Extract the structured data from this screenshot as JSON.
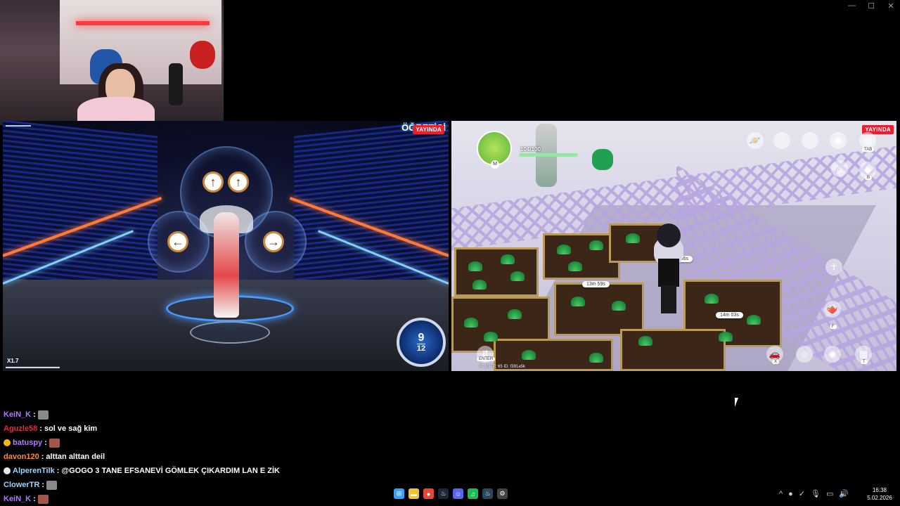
{
  "window": {
    "minimize_glyph": "—",
    "maximize_glyph": "☐",
    "close_glyph": "✕"
  },
  "left_game": {
    "top_right_title": "ÖĞRETİCİ",
    "live_badge": "YAYINDA",
    "combo_current": "9",
    "combo_total": "12",
    "multiplier": "X1.7",
    "arrow_up_1": "↑",
    "arrow_up_2": "↑",
    "arrow_left": "←",
    "arrow_right": "→"
  },
  "right_game": {
    "live_badge": "YAYINDA",
    "hp": "104/100",
    "minimap_key": "M",
    "timers": [
      "14m 06s",
      "13m 59s",
      "14m 03s"
    ],
    "enter_label": "ENTER",
    "tab_label": "TAB",
    "b_label": "B",
    "f_label": "F",
    "x_label": "X",
    "t_label": "T",
    "stats": "F: 109   P: 65   ID: f391a5k"
  },
  "chat": [
    {
      "user": "KeiN_K",
      "color": "#b27cff",
      "sep": ":",
      "message": "",
      "emote": "#8a8a8a",
      "badge": null
    },
    {
      "user": "Aguzle58",
      "color": "#e02b3c",
      "sep": ":",
      "message": "sol ve sağ kim",
      "emote": null,
      "badge": null
    },
    {
      "user": "batuspy",
      "color": "#b27cff",
      "sep": ":",
      "message": "",
      "emote": "#a0564a",
      "badge": "#f2b90c"
    },
    {
      "user": "davon120",
      "color": "#ff8a3a",
      "sep": ":",
      "message": "alttan alttan deil",
      "emote": null,
      "badge": null
    },
    {
      "user": "AlperenTilk",
      "color": "#9fd4ff",
      "sep": ":",
      "message": "@GOGO 3 TANE EFSANEVİ GÖMLEK ÇIKARDIM LAN E ZİK",
      "emote": null,
      "badge": "#e8e8e8"
    },
    {
      "user": "ClowerTR",
      "color": "#9fd4ff",
      "sep": ":",
      "message": "",
      "emote": "#8a8a8a",
      "badge": null
    },
    {
      "user": "KeiN_K",
      "color": "#b27cff",
      "sep": ":",
      "message": "",
      "emote": "#a0564a",
      "badge": null
    }
  ],
  "taskbar": {
    "apps": [
      {
        "name": "windows-start",
        "glyph": "⊞",
        "color": "#3aa0ff"
      },
      {
        "name": "file-explorer",
        "glyph": "▬",
        "color": "#f2c230"
      },
      {
        "name": "chrome",
        "glyph": "●",
        "color": "#e8453c"
      },
      {
        "name": "steam",
        "glyph": "♨",
        "color": "#1b2838"
      },
      {
        "name": "discord",
        "glyph": "☺",
        "color": "#5865f2"
      },
      {
        "name": "spotify",
        "glyph": "♫",
        "color": "#1db954"
      },
      {
        "name": "steam-2",
        "glyph": "♨",
        "color": "#2a475e"
      },
      {
        "name": "settings",
        "glyph": "⚙",
        "color": "#444"
      }
    ],
    "tray": [
      "^",
      "●",
      "✓",
      "🎙",
      "▭",
      "🔊"
    ],
    "time": "16:38",
    "date": "5.02.2026"
  }
}
